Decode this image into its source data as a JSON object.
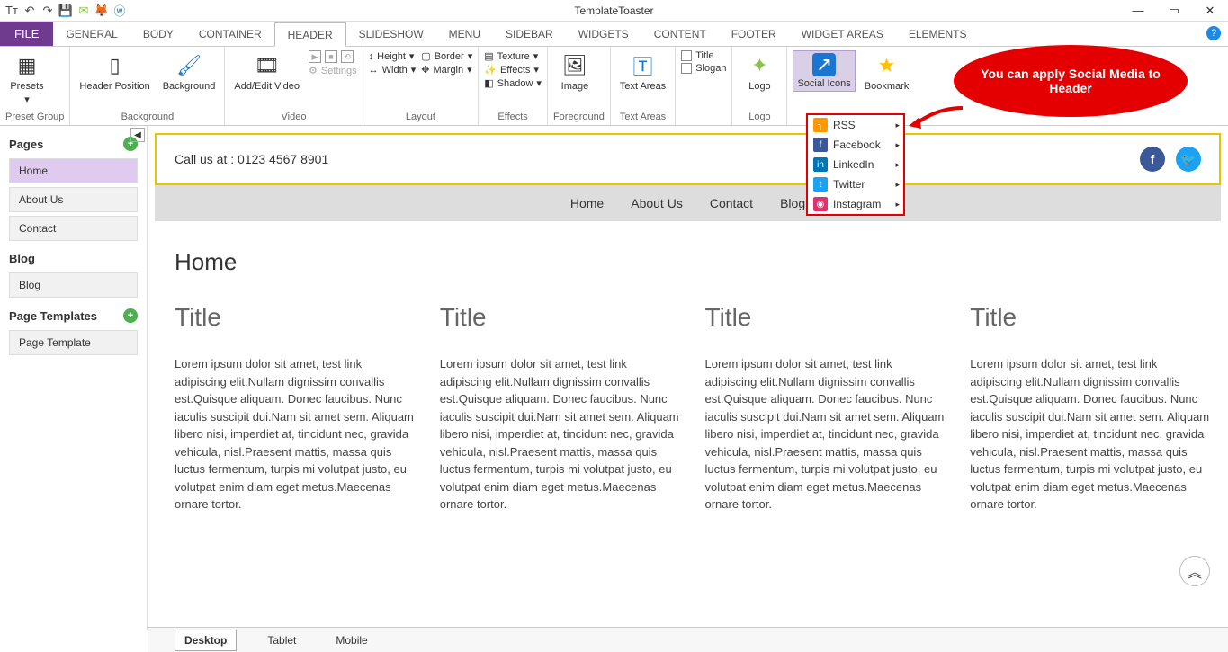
{
  "app": {
    "title": "TemplateToaster"
  },
  "tabs": {
    "file": "FILE",
    "items": [
      "GENERAL",
      "BODY",
      "CONTAINER",
      "HEADER",
      "SLIDESHOW",
      "MENU",
      "SIDEBAR",
      "WIDGETS",
      "CONTENT",
      "FOOTER",
      "WIDGET AREAS",
      "ELEMENTS"
    ],
    "active": "HEADER"
  },
  "ribbon": {
    "preset_group": {
      "label": "Preset Group",
      "presets": "Presets"
    },
    "background": {
      "label": "Background",
      "header_position": "Header Position",
      "background": "Background"
    },
    "video": {
      "label": "Video",
      "addedit": "Add/Edit Video",
      "settings": "Settings"
    },
    "layout": {
      "label": "Layout",
      "height": "Height",
      "border": "Border",
      "width": "Width",
      "margin": "Margin"
    },
    "effects": {
      "label": "Effects",
      "texture": "Texture",
      "effects": "Effects",
      "shadow": "Shadow"
    },
    "foreground": {
      "label": "Foreground",
      "image": "Image"
    },
    "textareas": {
      "label": "Text Areas",
      "ta": "Text Areas"
    },
    "title_slogan": {
      "title": "Title",
      "slogan": "Slogan"
    },
    "logo": {
      "label": "Logo",
      "logo": "Logo"
    },
    "social": {
      "label": "Social Icons"
    },
    "bookmark": {
      "label": "Bookmark"
    }
  },
  "dropdown": {
    "items": [
      {
        "label": "RSS",
        "color": "#ff9800"
      },
      {
        "label": "Facebook",
        "color": "#3b5998"
      },
      {
        "label": "LinkedIn",
        "color": "#0077b5"
      },
      {
        "label": "Twitter",
        "color": "#1da1f2"
      },
      {
        "label": "Instagram",
        "color": "#e1306c"
      }
    ]
  },
  "callout": "You can apply Social Media to Header",
  "sidebar": {
    "pages": "Pages",
    "page_items": [
      "Home",
      "About Us",
      "Contact"
    ],
    "blog": "Blog",
    "blog_items": [
      "Blog"
    ],
    "templates": "Page Templates",
    "tmpl_items": [
      "Page Template"
    ]
  },
  "header": {
    "call": "Call us at : 0123 4567 8901"
  },
  "menu": [
    "Home",
    "About Us",
    "Contact",
    "Blog"
  ],
  "page": {
    "title": "Home",
    "col_title": "Title",
    "lorem": "Lorem ipsum dolor sit amet, test link adipiscing elit.Nullam dignissim convallis est.Quisque aliquam. Donec faucibus. Nunc iaculis suscipit dui.Nam sit amet sem. Aliquam libero nisi, imperdiet at, tincidunt nec, gravida vehicula, nisl.Praesent mattis, massa quis luctus fermentum, turpis mi volutpat justo, eu volutpat enim diam eget metus.Maecenas ornare tortor."
  },
  "views": [
    "Desktop",
    "Tablet",
    "Mobile"
  ]
}
